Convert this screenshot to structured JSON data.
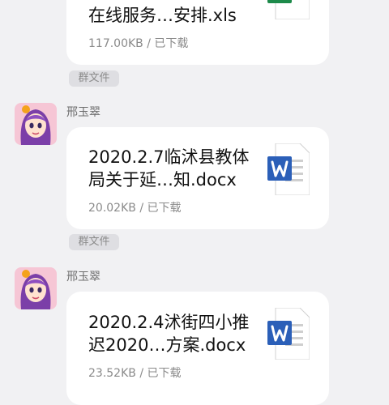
{
  "messages": [
    {
      "title_line2": "在线服务…安排.xls",
      "meta": "117.00KB / 已下载",
      "file_icon": "excel-icon",
      "tag": "群文件"
    },
    {
      "sender": "邢玉翠",
      "title_line1": "2020.2.7临沭县教体",
      "title_line2": "局关于延…知.docx",
      "meta": "20.02KB / 已下载",
      "file_icon": "word-icon",
      "tag": "群文件"
    },
    {
      "sender": "邢玉翠",
      "title_line1": "2020.2.4沭街四小推",
      "title_line2": "迟2020…方案.docx",
      "meta": "23.52KB / 已下载",
      "file_icon": "word-icon"
    }
  ],
  "colors": {
    "background": "#f1f1f3",
    "excel_green": "#1d8a4a",
    "word_blue": "#2b5fb8",
    "avatar_bg": "#f6c6d5",
    "hair_purple": "#7b3fa8"
  }
}
